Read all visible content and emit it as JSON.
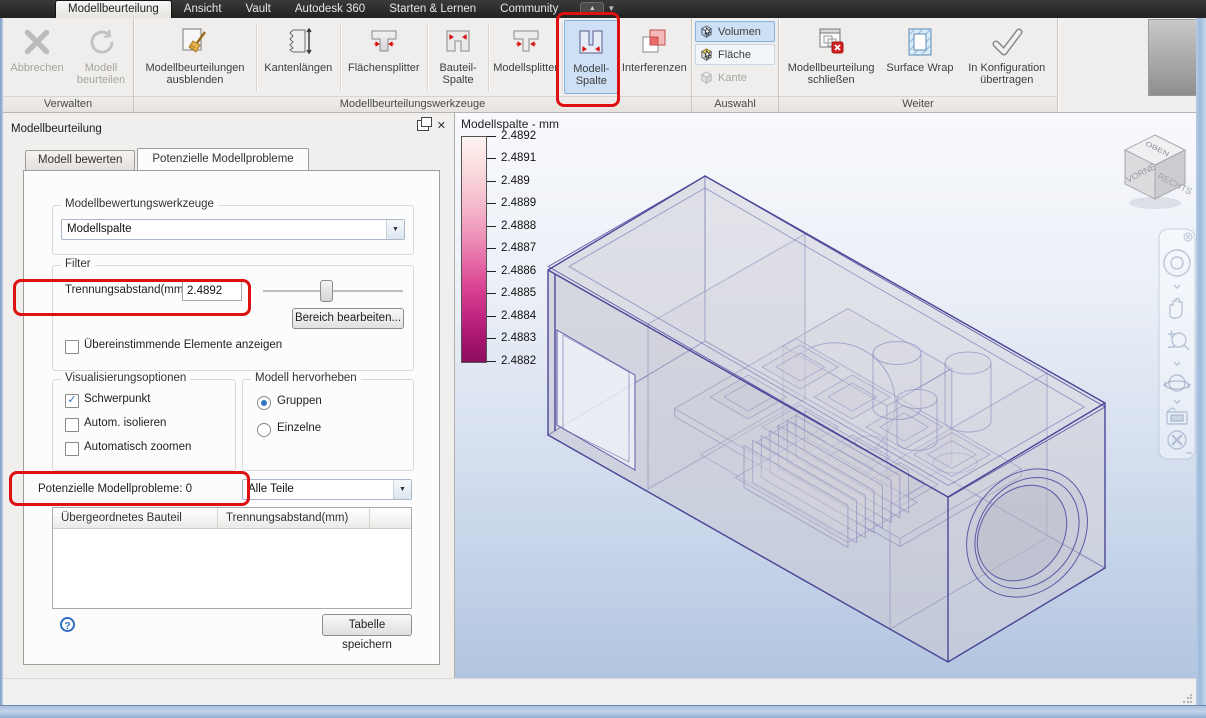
{
  "menu": {
    "tabs": [
      {
        "label": "Modellbeurteilung"
      },
      {
        "label": "Ansicht"
      },
      {
        "label": "Vault"
      },
      {
        "label": "Autodesk 360"
      },
      {
        "label": "Starten & Lernen"
      },
      {
        "label": "Community"
      }
    ],
    "active_tab": "Modellbeurteilung"
  },
  "ribbon": {
    "groups": {
      "verwalten": {
        "label": "Verwalten",
        "buttons": {
          "abbrechen": {
            "label": "Abbrechen",
            "disabled": true
          },
          "beurteilen": {
            "label": "Modell beurteilen",
            "disabled": true
          }
        }
      },
      "werkzeuge": {
        "label": "Modellbeurteilungswerkzeuge",
        "buttons": {
          "ausblenden": {
            "label": "Modellbeurteilungen ausblenden"
          },
          "kantenlaengen": {
            "label": "Kantenlängen"
          },
          "flaechensplitter": {
            "label": "Flächensplitter"
          },
          "bauteilspalte": {
            "label": "Bauteil-Spalte"
          },
          "modellsplitter": {
            "label": "Modellsplitter"
          },
          "modellspalte": {
            "label": "Modell-Spalte",
            "selected": true,
            "annotated": true
          },
          "interferenzen": {
            "label": "Interferenzen"
          }
        }
      },
      "auswahl": {
        "label": "Auswahl",
        "buttons": {
          "volumen": {
            "label": "Volumen",
            "selected": true
          },
          "flaeche": {
            "label": "Fläche"
          },
          "kante": {
            "label": "Kante",
            "disabled": true
          }
        }
      },
      "weiter": {
        "label": "Weiter",
        "buttons": {
          "schliessen": {
            "label": "Modellbeurteilung schließen"
          },
          "surfacewrap": {
            "label": "Surface Wrap"
          },
          "konfiguration": {
            "label": "In Konfiguration übertragen"
          }
        }
      }
    }
  },
  "panel": {
    "title": "Modellbeurteilung",
    "tabs": [
      {
        "label": "Modell bewerten"
      },
      {
        "label": "Potenzielle Modellprobleme",
        "active": true
      }
    ],
    "tools_group": {
      "label": "Modellbewertungswerkzeuge",
      "dropdown_value": "Modellspalte"
    },
    "filter": {
      "label": "Filter",
      "distance_label": "Trennungsabstand(mm)",
      "distance_value": "2.4892",
      "edit_range_button": "Bereich bearbeiten...",
      "matching_checkbox": {
        "label": "Übereinstimmende Elemente anzeigen",
        "checked": false
      }
    },
    "visualization": {
      "label": "Visualisierungsoptionen",
      "options": [
        {
          "label": "Schwerpunkt",
          "checked": true
        },
        {
          "label": "Autom. isolieren",
          "checked": false
        },
        {
          "label": "Automatisch zoomen",
          "checked": false
        }
      ]
    },
    "highlight": {
      "label": "Modell hervorheben",
      "options": [
        {
          "label": "Gruppen",
          "selected": true
        },
        {
          "label": "Einzelne",
          "selected": false
        }
      ]
    },
    "problems_label": "Potenzielle Modellprobleme: 0",
    "parts_dropdown_value": "Alle Teile",
    "table": {
      "columns": [
        "Übergeordnetes Bauteil",
        "Trennungsabstand(mm)"
      ],
      "rows": []
    },
    "save_table_button": "Tabelle speichern"
  },
  "viewport": {
    "legend": {
      "title": "Modellspalte - mm",
      "ticks": [
        "2.4892",
        "2.4891",
        "2.489",
        "2.4889",
        "2.4888",
        "2.4887",
        "2.4886",
        "2.4885",
        "2.4884",
        "2.4883",
        "2.4882"
      ],
      "color_top": "#fdf4f2",
      "color_mid": "#e0549c",
      "color_bottom": "#8c0d60"
    },
    "viewcube": {
      "top": "OBEN",
      "front": "VORNE",
      "right": "RECHTS"
    }
  },
  "annotations": {
    "color": "#dd1111"
  }
}
